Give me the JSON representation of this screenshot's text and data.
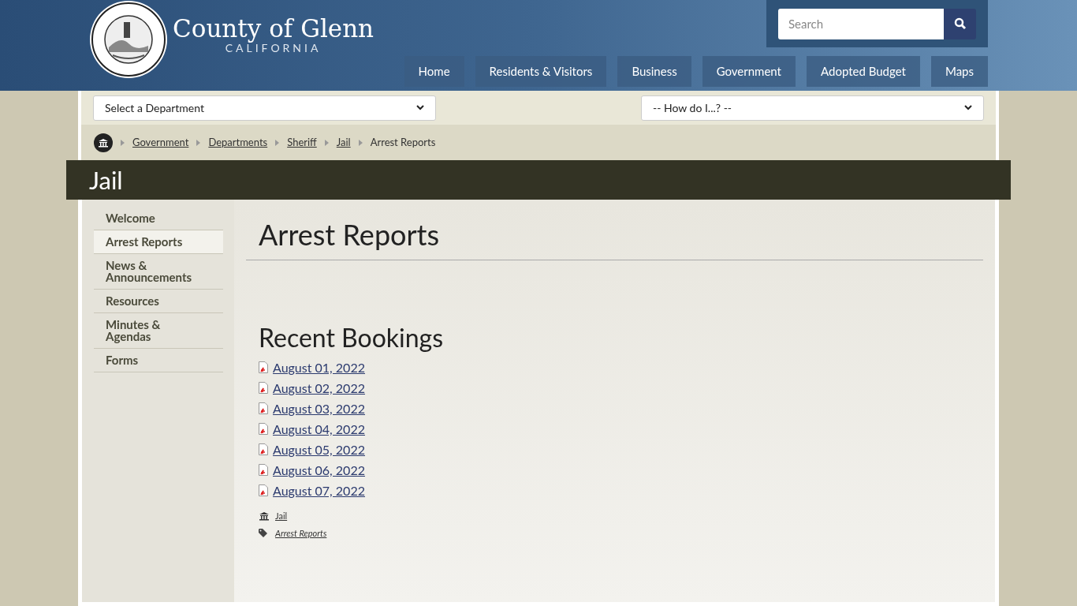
{
  "header": {
    "title": "County of Glenn",
    "subtitle": "CALIFORNIA",
    "search": {
      "placeholder": "Search"
    },
    "nav": [
      "Home",
      "Residents & Visitors",
      "Business",
      "Government",
      "Adopted Budget",
      "Maps"
    ]
  },
  "selects": {
    "department": "Select a Department",
    "how_do_i": "-- How do I...? --"
  },
  "breadcrumb": {
    "links": [
      "Government",
      "Departments",
      "Sheriff",
      "Jail"
    ],
    "current": "Arrest Reports"
  },
  "section_title": "Jail",
  "sidebar": [
    {
      "label": "Welcome",
      "selected": false
    },
    {
      "label": "Arrest Reports",
      "selected": true
    },
    {
      "label": "News & Announcements",
      "selected": false
    },
    {
      "label": "Resources",
      "selected": false
    },
    {
      "label": "Minutes & Agendas",
      "selected": false
    },
    {
      "label": "Forms",
      "selected": false
    }
  ],
  "page_title": "Arrest Reports",
  "heading": "Recent Bookings",
  "documents": [
    "August 01, 2022",
    "August 02, 2022",
    "August 03, 2022",
    "August 04, 2022",
    "August 05, 2022",
    "August 06, 2022",
    "August 07, 2022"
  ],
  "meta": {
    "department": "Jail",
    "tag": "Arrest Reports"
  }
}
